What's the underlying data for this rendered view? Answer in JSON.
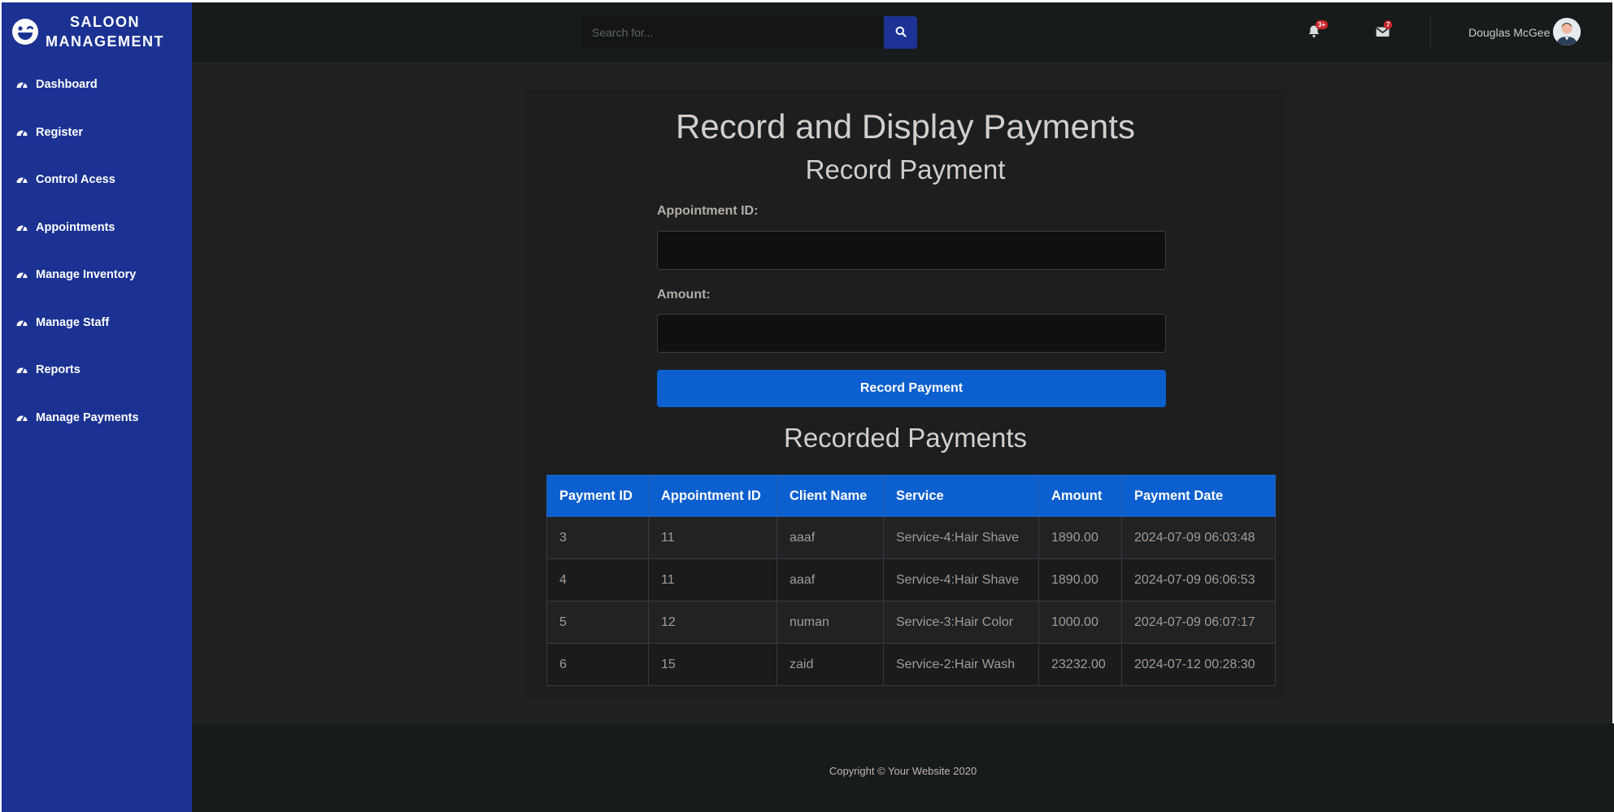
{
  "sidebar": {
    "brand_line1": "SALOON",
    "brand_line2": "MANAGEMENT",
    "items": [
      {
        "label": "Dashboard"
      },
      {
        "label": "Register"
      },
      {
        "label": "Control Acess"
      },
      {
        "label": "Appointments"
      },
      {
        "label": "Manage Inventory"
      },
      {
        "label": "Manage Staff"
      },
      {
        "label": "Reports"
      },
      {
        "label": "Manage Payments"
      }
    ]
  },
  "topbar": {
    "search_placeholder": "Search for...",
    "alerts_badge": "3+",
    "messages_badge": "7",
    "user_name": "Douglas McGee"
  },
  "main": {
    "title": "Record and Display Payments",
    "form_title": "Record Payment",
    "appointment_label": "Appointment ID:",
    "amount_label": "Amount:",
    "submit_label": "Record Payment",
    "table_title": "Recorded Payments"
  },
  "table": {
    "headers": [
      "Payment ID",
      "Appointment ID",
      "Client Name",
      "Service",
      "Amount",
      "Payment Date"
    ],
    "rows": [
      [
        "3",
        "11",
        "aaaf",
        "Service-4:Hair Shave",
        "1890.00",
        "2024-07-09 06:03:48"
      ],
      [
        "4",
        "11",
        "aaaf",
        "Service-4:Hair Shave",
        "1890.00",
        "2024-07-09 06:06:53"
      ],
      [
        "5",
        "12",
        "numan",
        "Service-3:Hair Color",
        "1000.00",
        "2024-07-09 06:07:17"
      ],
      [
        "6",
        "15",
        "zaid",
        "Service-2:Hair Wash",
        "23232.00",
        "2024-07-12 00:28:30"
      ]
    ]
  },
  "footer": {
    "copyright": "Copyright © Your Website 2020"
  },
  "colors": {
    "sidebar": "#1b3293",
    "primary": "#0c5fce",
    "badge": "#c8262b"
  },
  "icons": {
    "brand": "laugh-wink-icon",
    "nav": "tachometer-icon",
    "search": "search-icon",
    "alerts": "bell-icon",
    "messages": "envelope-icon"
  }
}
